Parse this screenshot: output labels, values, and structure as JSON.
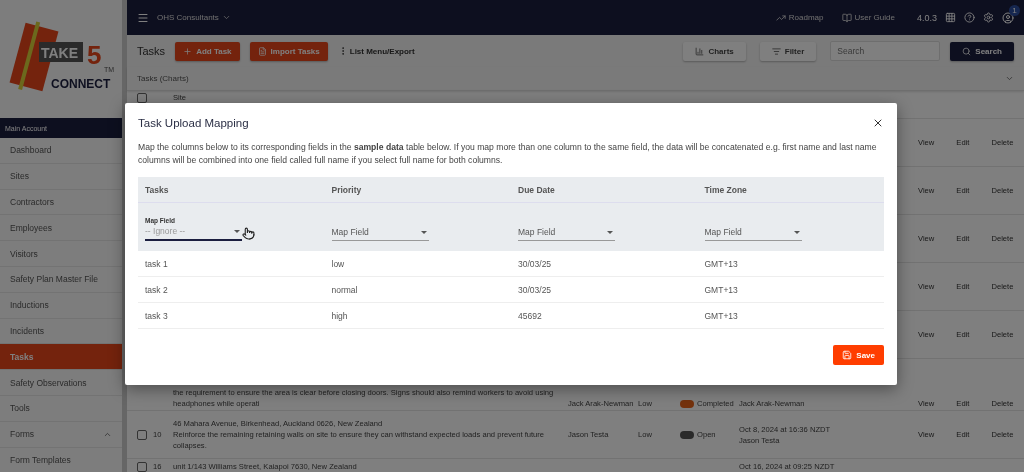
{
  "logo": {
    "parts": [
      "TAKE",
      "5",
      "CONNECT"
    ],
    "mark": "TM"
  },
  "sidebar": {
    "section": "Main Account",
    "items": [
      {
        "label": "Dashboard",
        "selected": false
      },
      {
        "label": "Sites",
        "selected": false
      },
      {
        "label": "Contractors",
        "selected": false
      },
      {
        "label": "Employees",
        "selected": false
      },
      {
        "label": "Visitors",
        "selected": false
      },
      {
        "label": "Safety Plan Master File",
        "selected": false
      },
      {
        "label": "Inductions",
        "selected": false
      },
      {
        "label": "Incidents",
        "selected": false
      },
      {
        "label": "Tasks",
        "selected": true
      },
      {
        "label": "Safety Observations",
        "selected": false
      },
      {
        "label": "Tools",
        "selected": false
      },
      {
        "label": "Forms",
        "selected": false,
        "expanded": true
      },
      {
        "label": "Form Templates",
        "selected": false
      }
    ]
  },
  "topbar": {
    "company": "OHS Consultants",
    "links": [
      "Roadmap",
      "User Guide"
    ],
    "version": "4.0.3",
    "notifications": "1"
  },
  "toolbar": {
    "title": "Tasks",
    "add": "Add Task",
    "import": "Import Tasks",
    "menu": "List Menu/Export",
    "charts": "Charts",
    "filter": "Filter",
    "search_placeholder": "Search",
    "search": "Search"
  },
  "charts_panel": {
    "label": "Tasks (Charts)",
    "expanded": false
  },
  "table": {
    "header": "Site",
    "checked": false,
    "rows": [
      {
        "actions": [
          "View",
          "Edit",
          "Delete"
        ]
      },
      {
        "actions": [
          "View",
          "Edit",
          "Delete"
        ]
      },
      {
        "actions": [
          "View",
          "Edit",
          "Delete"
        ]
      },
      {
        "actions": [
          "View",
          "Edit",
          "Delete"
        ]
      },
      {
        "actions": [
          "View",
          "Edit",
          "Delete"
        ]
      },
      {
        "lines": [
          "the requirement to ensure the area is clear before closing doors. Signs should also remind workers to avoid using",
          "headphones while operati"
        ],
        "assignee": "Jack Arak-Newman",
        "priority": "Low",
        "status": {
          "label": "Completed",
          "done": true
        },
        "updated": [
          "Jack Arak-Newman"
        ],
        "actions": [
          "View",
          "Edit",
          "Delete"
        ]
      },
      {
        "number": "10",
        "checked": false,
        "lines": [
          "46 Mahara Avenue, Birkenhead, Auckland 0626, New Zealand",
          "Reinforce the remaining retaining walls on site to ensure they can withstand expected loads and prevent future",
          "collapses."
        ],
        "assignee": "Jason Testa",
        "priority": "Low",
        "status": {
          "label": "Open",
          "done": false
        },
        "updated": [
          "Oct 8, 2024 at 16:36 NZDT",
          "Jason Testa"
        ],
        "actions": [
          "View",
          "Edit",
          "Delete"
        ]
      },
      {
        "number": "16",
        "checked": false,
        "lines": [
          "unit 1/143 Williams Street, Kaiapoi 7630, New Zealand"
        ],
        "updated": [
          "Oct 16, 2024 at 09:25 NZDT"
        ]
      }
    ]
  },
  "dialog": {
    "title": "Task Upload Mapping",
    "description": "Map the columns below to its corresponding fields in the **sample data** table below. If you map more than one column to the same field, the data will be concatenated e.g. first name and last name columns will be combined into one field called full name if you select full name for both columns.",
    "columns": [
      "Tasks",
      "Priority",
      "Due Date",
      "Time Zone"
    ],
    "mappings": [
      {
        "label": "Map Field",
        "value": "-- Ignore --",
        "focused": true
      },
      {
        "label": "Map Field",
        "focused": false
      },
      {
        "label": "Map Field",
        "focused": false
      },
      {
        "label": "Map Field",
        "focused": false
      }
    ],
    "rows": [
      [
        "task 1",
        "low",
        "30/03/25",
        "GMT+13"
      ],
      [
        "task 2",
        "normal",
        "30/03/25",
        "GMT+13"
      ],
      [
        "task 3",
        "high",
        "45692",
        "GMT+13"
      ]
    ],
    "save": "Save"
  }
}
